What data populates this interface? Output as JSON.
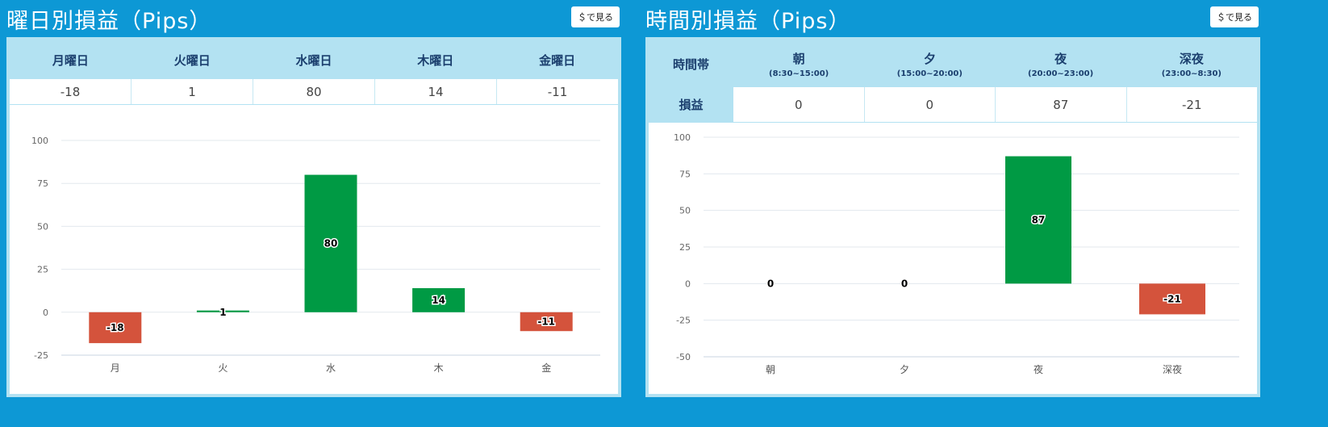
{
  "weekday_panel": {
    "title": "曜日別損益（Pips）",
    "usd_button": "＄で見る",
    "columns": [
      {
        "label": "月曜日",
        "value": "-18"
      },
      {
        "label": "火曜日",
        "value": "1"
      },
      {
        "label": "水曜日",
        "value": "80"
      },
      {
        "label": "木曜日",
        "value": "14"
      },
      {
        "label": "金曜日",
        "value": "-11"
      }
    ]
  },
  "time_panel": {
    "title": "時間別損益（Pips）",
    "usd_button": "＄で見る",
    "header_label": "時間帯",
    "row_label": "損益",
    "columns": [
      {
        "label": "朝",
        "range": "(8:30~15:00)",
        "value": "0"
      },
      {
        "label": "夕",
        "range": "(15:00~20:00)",
        "value": "0"
      },
      {
        "label": "夜",
        "range": "(20:00~23:00)",
        "value": "87"
      },
      {
        "label": "深夜",
        "range": "(23:00~8:30)",
        "value": "-21"
      }
    ]
  },
  "colors": {
    "positive": "#009a44",
    "negative": "#d4533c",
    "header_bg": "#b3e2f2",
    "page_bg": "#0d98d5"
  },
  "chart_data": [
    {
      "type": "bar",
      "categories": [
        "月",
        "火",
        "水",
        "木",
        "金"
      ],
      "values": [
        -18,
        1,
        80,
        14,
        -11
      ],
      "title": "曜日別損益（Pips）",
      "ylim": [
        -25,
        100
      ],
      "yticks": [
        100,
        75,
        50,
        25,
        0,
        -25
      ],
      "grid": true
    },
    {
      "type": "bar",
      "categories": [
        "朝",
        "夕",
        "夜",
        "深夜"
      ],
      "values": [
        0,
        0,
        87,
        -21
      ],
      "title": "時間別損益（Pips）",
      "ylim": [
        -50,
        100
      ],
      "yticks": [
        100,
        75,
        50,
        25,
        0,
        -25,
        -50
      ],
      "grid": true
    }
  ]
}
